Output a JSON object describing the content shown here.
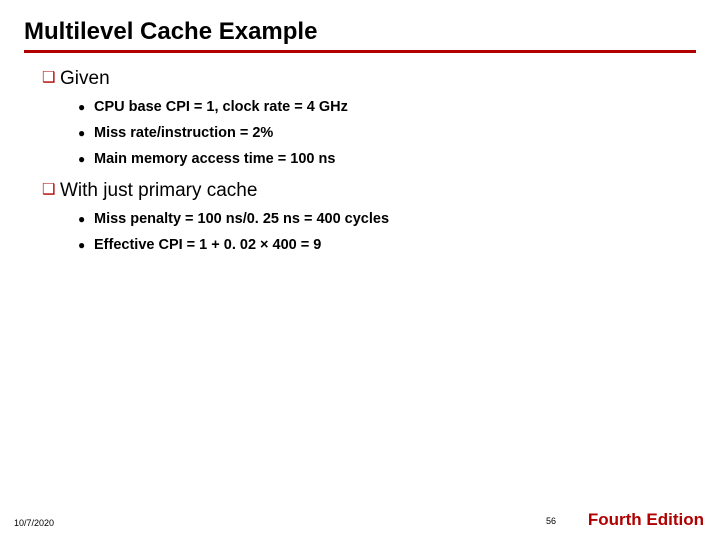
{
  "title": "Multilevel Cache Example",
  "sections": {
    "0": {
      "heading": "Given",
      "items": {
        "0": "CPU base CPI = 1, clock rate = 4 GHz",
        "1": "Miss rate/instruction = 2%",
        "2": "Main memory access time = 100 ns"
      }
    },
    "1": {
      "heading": "With just primary cache",
      "items": {
        "0": "Miss penalty = 100 ns/0. 25 ns = 400 cycles",
        "1": "Effective CPI = 1 + 0. 02 × 400 = 9"
      }
    }
  },
  "footer": {
    "date": "10/7/2020",
    "page": "56",
    "edition": "Fourth Edition"
  }
}
